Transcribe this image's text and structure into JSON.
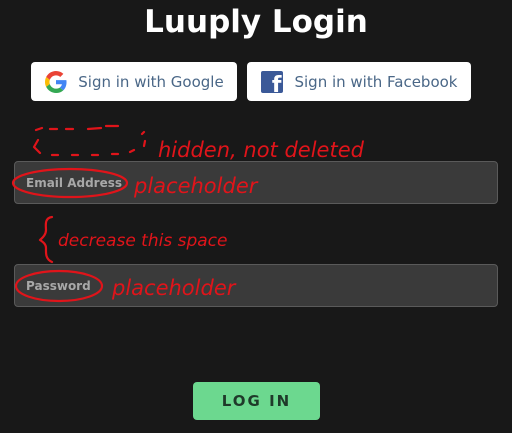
{
  "title": "Luuply Login",
  "social": {
    "google_label": "Sign in with Google",
    "facebook_label": "Sign in with Facebook",
    "google_icon": "google-g-icon",
    "facebook_icon": "facebook-f-icon"
  },
  "form": {
    "email_placeholder": "Email Address",
    "email_value": "",
    "password_placeholder": "Password",
    "password_value": ""
  },
  "login_label": "LOG IN",
  "annotations": {
    "hidden_note": "hidden, not deleted",
    "email_note": "placeholder",
    "space_note": "decrease this space",
    "password_note": "placeholder",
    "color": "#e0141a"
  },
  "colors": {
    "background": "#181818",
    "field_background": "#3a3a3a",
    "field_border": "#5a5a5a",
    "login_green": "#6cd88f",
    "social_text": "#4a6787",
    "facebook_blue": "#3b5998"
  }
}
